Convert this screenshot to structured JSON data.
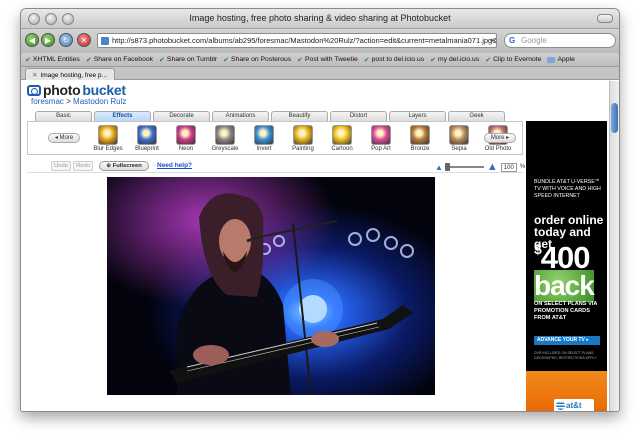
{
  "window": {
    "title": "Image hosting, free photo sharing & video sharing at Photobucket"
  },
  "toolbar": {
    "url": "http://s873.photobucket.com/albums/ab295/foresmac/Mastodon%20Rulz/?action=edit&current=metalmania071.jpg&startOpt",
    "search_placeholder": "Google"
  },
  "bookmarks": [
    {
      "label": "XHTML Entities",
      "icon": "check-icon"
    },
    {
      "label": "Share on Facebook",
      "icon": "check-icon"
    },
    {
      "label": "Share on Tumblr",
      "icon": "check-icon"
    },
    {
      "label": "Share on Posterous",
      "icon": "check-icon"
    },
    {
      "label": "Post with Tweetie",
      "icon": "check-icon"
    },
    {
      "label": "post to del.icio.us",
      "icon": "check-icon"
    },
    {
      "label": "my del.icio.us",
      "icon": "check-icon"
    },
    {
      "label": "Clip to Evernote",
      "icon": "check-icon"
    },
    {
      "label": "Apple",
      "icon": "folder-icon"
    }
  ],
  "browser_tab": {
    "label": "Image hosting, free p..."
  },
  "site": {
    "logo_text_dark": "photo",
    "logo_text_blue": "bucket",
    "breadcrumb": {
      "user": "foresmac",
      "separator": ">",
      "album": "Mastodon Rulz"
    }
  },
  "editor": {
    "tabs": [
      "Basic",
      "Effects",
      "Decorate",
      "Animations",
      "Beautify",
      "Distort",
      "Layers",
      "Geek"
    ],
    "active_tab": "Effects",
    "more_label": "More",
    "effects": [
      {
        "label": "Blur Edges",
        "color": "#e8a316"
      },
      {
        "label": "Blueprint",
        "color": "#3d6fd0"
      },
      {
        "label": "Neon",
        "color": "#d23a8a"
      },
      {
        "label": "Greyscale",
        "color": "#888888"
      },
      {
        "label": "Invert",
        "color": "#3a8fd6"
      },
      {
        "label": "Painting",
        "color": "#e6b21a"
      },
      {
        "label": "Cartoon",
        "color": "#f0c020"
      },
      {
        "label": "Pop Art",
        "color": "#e04a9a"
      },
      {
        "label": "Bronze",
        "color": "#b5783a"
      },
      {
        "label": "Sepia",
        "color": "#b88a5a"
      },
      {
        "label": "Old Photo",
        "color": "#c07070"
      }
    ],
    "undo_label": "Undo",
    "redo_label": "Redo",
    "fullscreen_label": "Fullscreen",
    "help_label": "Need help?",
    "zoom_value": "100",
    "zoom_unit": "%"
  },
  "ad": {
    "headline_small": "BUNDLE AT&T U-VERSE℠ TV WITH VOICE AND HIGH SPEED INTERNET",
    "headline_big": "order online today and get",
    "amount": "400",
    "currency": "$",
    "back": "back",
    "promo": "ON SELECT PLANS VIA PROMOTION CARDS FROM AT&T",
    "cta": "ADVANCE YOUR TV ▸",
    "fine": "DVR INCLUDED ON SELECT PLANS. GEOGRAPHIC RESTRICTIONS APPLY.",
    "brand": "at&t"
  }
}
